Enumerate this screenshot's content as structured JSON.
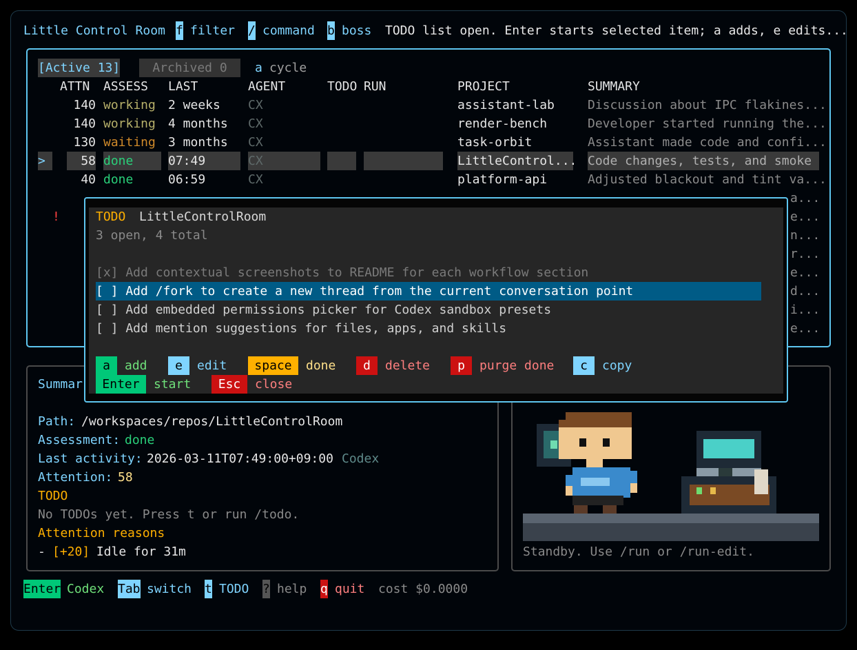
{
  "topbar": {
    "title": "Little Control Room",
    "filter_key": "f",
    "filter_label": "filter",
    "command_key": "/",
    "command_label": "command",
    "boss_key": "b",
    "boss_label": "boss",
    "status": "TODO list open. Enter starts selected item; a adds, e edits..."
  },
  "tabs": {
    "active": "[Active 13]",
    "archived": "Archived 0",
    "cycle_key": "a",
    "cycle_label": "cycle"
  },
  "columns": [
    "ATTN",
    "ASSESS",
    "LAST",
    "AGENT",
    "TODO",
    "RUN",
    "PROJECT",
    "SUMMARY"
  ],
  "rows": [
    {
      "marker": "",
      "attn": "140",
      "assess": "working",
      "last": "2 weeks",
      "agent": "CX",
      "project": "assistant-lab",
      "summary": "Discussion about IPC flakines..."
    },
    {
      "marker": "",
      "attn": "140",
      "assess": "working",
      "last": "4 months",
      "agent": "CX",
      "project": "render-bench",
      "summary": "Developer started running the..."
    },
    {
      "marker": "",
      "attn": "130",
      "assess": "waiting",
      "last": "3 months",
      "agent": "CX",
      "project": "task-orbit",
      "summary": "Assistant made code and confi..."
    },
    {
      "marker": ">",
      "attn": "58",
      "assess": "done",
      "last": "07:49",
      "agent": "CX",
      "project": "LittleControl...",
      "summary": "Code changes, tests, and smoke c"
    },
    {
      "marker": "",
      "attn": "40",
      "assess": "done",
      "last": "06:59",
      "agent": "CX",
      "project": "platform-api",
      "summary": "Adjusted blackout and tint va..."
    }
  ],
  "hidden_rows": {
    "warning_mark": "!",
    "summary_tails": [
      "a...",
      "e...",
      "n...",
      "r...",
      "e...",
      "d...",
      "i...",
      "e..."
    ]
  },
  "todo_popup": {
    "label": "TODO",
    "project": "LittleControlRoom",
    "counts": "3 open, 4 total",
    "items": [
      "[x] Add contextual screenshots to README for each workflow section",
      "[ ] Add /fork to create a new thread from the current conversation point",
      "[ ] Add embedded permissions picker for Codex sandbox presets",
      "[ ] Add mention suggestions for files, apps, and skills"
    ],
    "keys": {
      "add_key": "a",
      "add_label": "add",
      "edit_key": "e",
      "edit_label": "edit",
      "done_key": "space",
      "done_label": "done",
      "delete_key": "d",
      "delete_label": "delete",
      "purge_key": "p",
      "purge_label": "purge done",
      "copy_key": "c",
      "copy_label": "copy",
      "start_key": "Enter",
      "start_label": "start",
      "close_key": "Esc",
      "close_label": "close"
    }
  },
  "detail": {
    "heading": "Summar",
    "path_label": "Path:",
    "path_value": "/workspaces/repos/LittleControlRoom",
    "assessment_label": "Assessment:",
    "assessment_value": "done",
    "activity_label": "Last activity:",
    "activity_value": "2026-03-11T07:49:00+09:00",
    "activity_agent": "Codex",
    "attention_label": "Attention:",
    "attention_value": "58",
    "todo_label": "TODO",
    "todo_text": "No TODOs yet. Press t or run /todo.",
    "reasons_label": "Attention reasons",
    "reason_prefix": "- ",
    "reason_score": "[+20]",
    "reason_text": " Idle for 31m"
  },
  "scene": {
    "status": "Standby. Use /run or /run-edit."
  },
  "footer": {
    "enter_key": "Enter",
    "enter_label": "Codex",
    "tab_key": "Tab",
    "tab_label": "switch",
    "todo_key": "t",
    "todo_label": "TODO",
    "help_key": "?",
    "help_label": "help",
    "quit_key": "q",
    "quit_label": "quit",
    "cost": "cost $0.0000"
  },
  "colors": {
    "accent": "#7fd4ff",
    "done": "#2ad07a",
    "waiting": "#e6b94a",
    "working": "#b7b06a",
    "selected": "#005b86",
    "danger": "#cc1111",
    "warn": "#ffb000"
  }
}
